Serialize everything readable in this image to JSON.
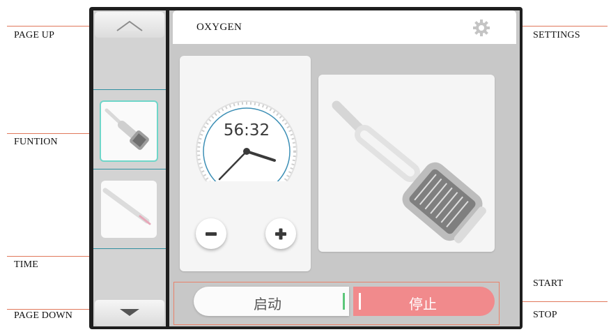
{
  "annotations": {
    "page_up": "PAGE UP",
    "funtion": "FUNTION",
    "time": "TIME",
    "page_down": "PAGE DOWN",
    "settings": "SETTINGS",
    "start": "START",
    "stop": "STOP"
  },
  "header": {
    "title": "OXYGEN",
    "settings_icon": "gear-icon"
  },
  "sidebar": {
    "page_up_icon": "chevron-up-icon",
    "page_down_icon": "chevron-down-icon",
    "items": [
      {
        "name": "oxygen-handpiece",
        "selected": true
      },
      {
        "name": "pen-handpiece",
        "selected": false
      }
    ]
  },
  "timer": {
    "time": "56:32",
    "minus_icon": "minus-icon",
    "plus_icon": "plus-icon"
  },
  "controls": {
    "start_label": "启动",
    "stop_label": "停止"
  },
  "colors": {
    "accent_line": "#e0775a",
    "selected_border": "#6fd6c9",
    "stop_button": "#f18a8c",
    "start_indicator": "#5cc77a",
    "clock_ring": "#3d8fb5"
  }
}
